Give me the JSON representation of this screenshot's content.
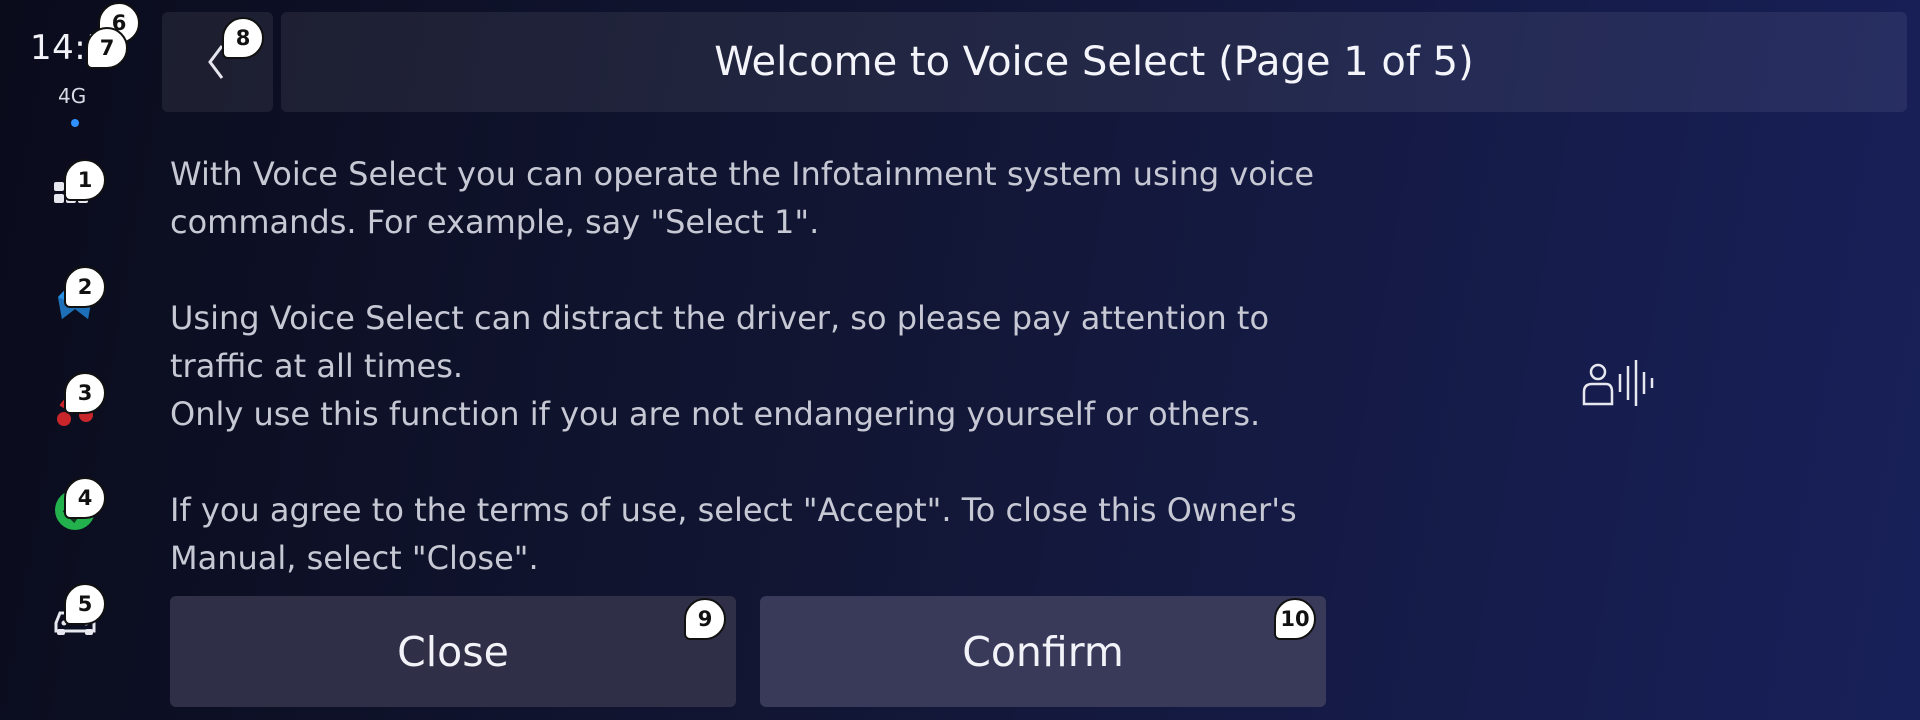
{
  "status": {
    "time": "14:5",
    "network": "4G"
  },
  "header": {
    "title": "Welcome to Voice Select (Page 1 of 5)"
  },
  "content": {
    "paragraph1": "With Voice Select you can operate the Infotainment system using voice commands. For example, say \"Select 1\".",
    "paragraph2_line1": "Using Voice Select can distract the driver, so please pay attention to traffic at all times.",
    "paragraph2_line2": "Only use this function if you are not endangering yourself or others.",
    "paragraph3": "If you agree to the terms of use, select \"Accept\". To close this Owner's Manual, select \"Close\"."
  },
  "buttons": {
    "close": "Close",
    "confirm": "Confirm"
  },
  "badges": [
    "1",
    "2",
    "3",
    "4",
    "5",
    "6",
    "7",
    "8",
    "9",
    "10"
  ],
  "colors": {
    "accent_blue": "#2f8fff",
    "nav_blue": "#2a8fe0",
    "phone_red": "#c8262b",
    "app_green": "#22b14c"
  },
  "icons": {
    "rail": [
      "apps-icon",
      "navigation-icon",
      "phone-icon",
      "app-store-icon",
      "car-icon"
    ],
    "back": "chevron-left-icon",
    "voice": "voice-select-icon"
  }
}
